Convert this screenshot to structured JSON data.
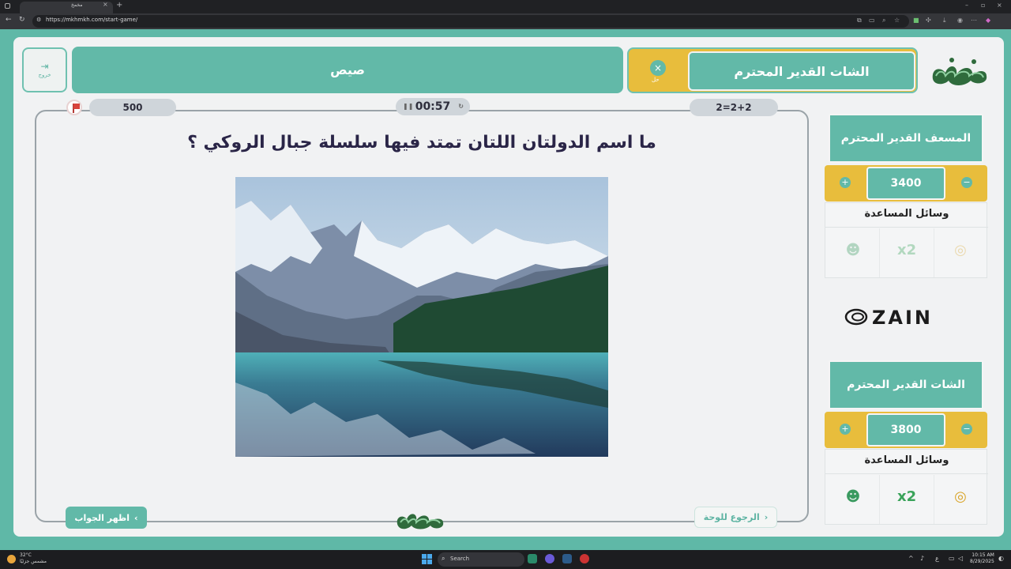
{
  "browser": {
    "tab_title": "مخمخ",
    "url": "https://mkhmkh.com/start-game/"
  },
  "game": {
    "exit_label": "خروج",
    "category": "صيص",
    "current_team": "الشات القدير المحترم",
    "turn_label": "حل",
    "score_pill": "500",
    "timer": "00:57",
    "equation": "2=2+2",
    "question": "ما اسم الدولتان اللتان تمتد فيها سلسلة جبال الروكي ؟",
    "reveal_button": "اظهر الجواب",
    "back_button": "الرجوع للوحة"
  },
  "teams": [
    {
      "name": "المسعف القدير المحترم",
      "score": "3400",
      "aids_title": "وسائل المساعدة"
    },
    {
      "name": "الشات القدير المحترم",
      "score": "3800",
      "aids_title": "وسائل المساعدة"
    }
  ],
  "sponsor": "ZAIN",
  "taskbar": {
    "weather_temp": "32°C",
    "weather_desc": "مشمس جزئيًا",
    "search": "Search",
    "time": "10:15 AM",
    "date": "8/29/2025"
  },
  "colors": {
    "teal": "#62b9a8",
    "yellow": "#e8bd3c",
    "navy_text": "#2a2547"
  }
}
